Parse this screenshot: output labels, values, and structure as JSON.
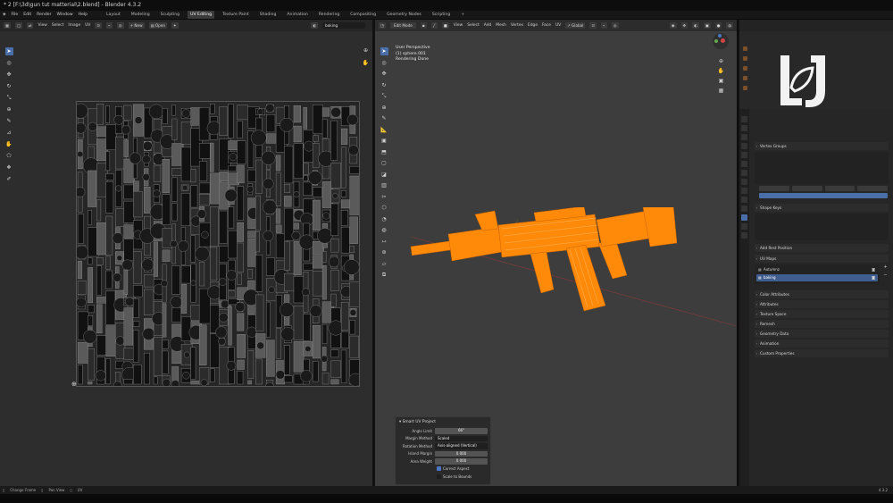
{
  "window": {
    "title": "* 2 [F:\\3d\\gun tut matterial\\2.blend] - Blender 4.3.2"
  },
  "menubar": {
    "items": [
      "File",
      "Edit",
      "Render",
      "Window",
      "Help"
    ],
    "workspaces": [
      "Layout",
      "Modeling",
      "Sculpting",
      "UV Editing",
      "Texture Paint",
      "Shading",
      "Animation",
      "Rendering",
      "Compositing",
      "Geometry Nodes",
      "Scripting"
    ],
    "active_workspace": "UV Editing",
    "add_tab": "+"
  },
  "uv_editor": {
    "header": {
      "menus": [
        "View",
        "Select",
        "Image",
        "UV"
      ],
      "new_label": "New",
      "open_label": "Open",
      "image_name": "baking"
    }
  },
  "viewport": {
    "header": {
      "mode": "Edit Mode",
      "menus": [
        "View",
        "Select",
        "Add",
        "Mesh",
        "Vertex",
        "Edge",
        "Face",
        "UV"
      ],
      "orientation": "Global"
    },
    "info": {
      "line1": "User Perspective",
      "line2": "(1) sphere.001",
      "line3": "Rendering Done"
    }
  },
  "smart_uv_panel": {
    "title": "Smart UV Project",
    "angle_limit_label": "Angle Limit",
    "angle_limit": "66°",
    "margin_method_label": "Margin Method",
    "margin_method": "Scaled",
    "rotation_method_label": "Rotation Method",
    "rotation_method": "Axis-aligned (Vertical)",
    "island_margin_label": "Island Margin",
    "island_margin": "0.000",
    "area_weight_label": "Area Weight",
    "area_weight": "0.000",
    "correct_aspect_label": "Correct Aspect",
    "correct_aspect": true,
    "scale_to_bounds_label": "Scale to Bounds",
    "scale_to_bounds": false
  },
  "properties": {
    "sections": [
      "Vertex Groups",
      "Shape Keys",
      "Add Rest Position",
      "UV Maps",
      "Color Attributes",
      "Attributes",
      "Texture Space",
      "Remesh",
      "Geometry Data",
      "Animation",
      "Custom Properties"
    ],
    "uv_maps": [
      "Autumnz",
      "baking"
    ],
    "active_uv_map": "baking"
  },
  "statusbar": {
    "items": [
      "Change Frame",
      "Pan View",
      "UV"
    ],
    "version": "4.3.2"
  },
  "colors": {
    "accent": "#4a6fa8",
    "mesh": "#ff8a0a",
    "viewport_bg": "#3d3d3d",
    "panel_bg": "#262626"
  }
}
